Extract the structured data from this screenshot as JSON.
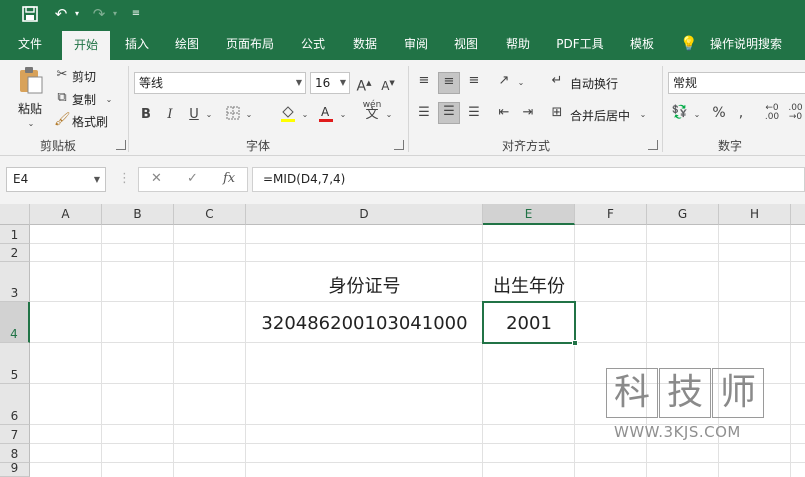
{
  "qat": {
    "save_icon": "save-icon",
    "undo_icon": "undo-icon",
    "redo_icon": "redo-icon",
    "customize_icon": "customize-qat-icon"
  },
  "tabs": [
    {
      "label": "文件"
    },
    {
      "label": "开始"
    },
    {
      "label": "插入"
    },
    {
      "label": "绘图"
    },
    {
      "label": "页面布局"
    },
    {
      "label": "公式"
    },
    {
      "label": "数据"
    },
    {
      "label": "审阅"
    },
    {
      "label": "视图"
    },
    {
      "label": "帮助"
    },
    {
      "label": "PDF工具"
    },
    {
      "label": "模板"
    }
  ],
  "tell_me": {
    "label": "操作说明搜索"
  },
  "ribbon": {
    "clipboard": {
      "paste": "粘贴",
      "cut": "剪切",
      "copy": "复制",
      "format_painter": "格式刷",
      "group": "剪贴板"
    },
    "font": {
      "name": "等线",
      "size": "16",
      "bold": "B",
      "italic": "I",
      "underline": "U",
      "group": "字体",
      "grow": "A",
      "shrink": "A",
      "phonetic": "wén"
    },
    "alignment": {
      "wrap": "自动换行",
      "merge": "合并后居中",
      "group": "对齐方式"
    },
    "number": {
      "format": "常规",
      "percent": "%",
      "comma": ",",
      "group": "数字"
    }
  },
  "formula_bar": {
    "name_box": "E4",
    "fx": "fx",
    "formula": "=MID(D4,7,4)"
  },
  "columns": [
    "A",
    "B",
    "C",
    "D",
    "E",
    "F",
    "G",
    "H"
  ],
  "rows": [
    "1",
    "2",
    "3",
    "4",
    "5",
    "6",
    "7",
    "8",
    "9"
  ],
  "cells": {
    "D3": "身份证号",
    "E3": "出生年份",
    "D4": "320486200103041000",
    "E4": "2001"
  },
  "watermark": {
    "chars": [
      "科",
      "技",
      "师"
    ],
    "url": "WWW.3KJS.COM"
  },
  "colors": {
    "accent": "#217346"
  }
}
